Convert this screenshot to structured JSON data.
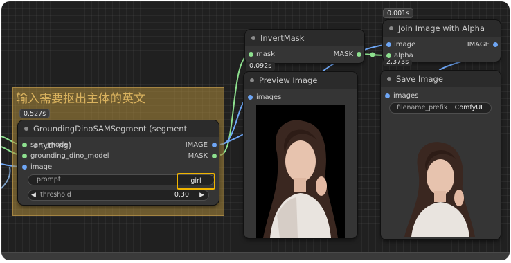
{
  "group": {
    "title": "输入需要抠出主体的英文"
  },
  "nodes": {
    "grounding": {
      "title": "GroundingDinoSAMSegment (segment anything)",
      "timing": "0.527s",
      "inputs": [
        "sam_model",
        "grounding_dino_model",
        "image"
      ],
      "outputs": [
        "IMAGE",
        "MASK"
      ],
      "prompt_label": "prompt",
      "prompt_value": "girl",
      "threshold_label": "threshold",
      "threshold_value": "0.30",
      "arrow_left": "◀",
      "arrow_right": "▶"
    },
    "invert": {
      "title": "InvertMask",
      "timing": "0.092s",
      "input": "mask",
      "output": "MASK"
    },
    "preview": {
      "title": "Preview Image",
      "input": "images"
    },
    "join": {
      "title": "Join Image with Alpha",
      "timing": "0.001s",
      "inputs": [
        "image",
        "alpha"
      ],
      "output": "IMAGE"
    },
    "save": {
      "title": "Save Image",
      "timing": "2.373s",
      "input": "images",
      "filename_label": "filename_prefix",
      "filename_value": "ComfyUI"
    }
  },
  "colors": {
    "image_socket": "#6ea6f5",
    "mask_socket": "#8de08e",
    "highlight": "#f0b400",
    "group": "#af8c3c"
  }
}
